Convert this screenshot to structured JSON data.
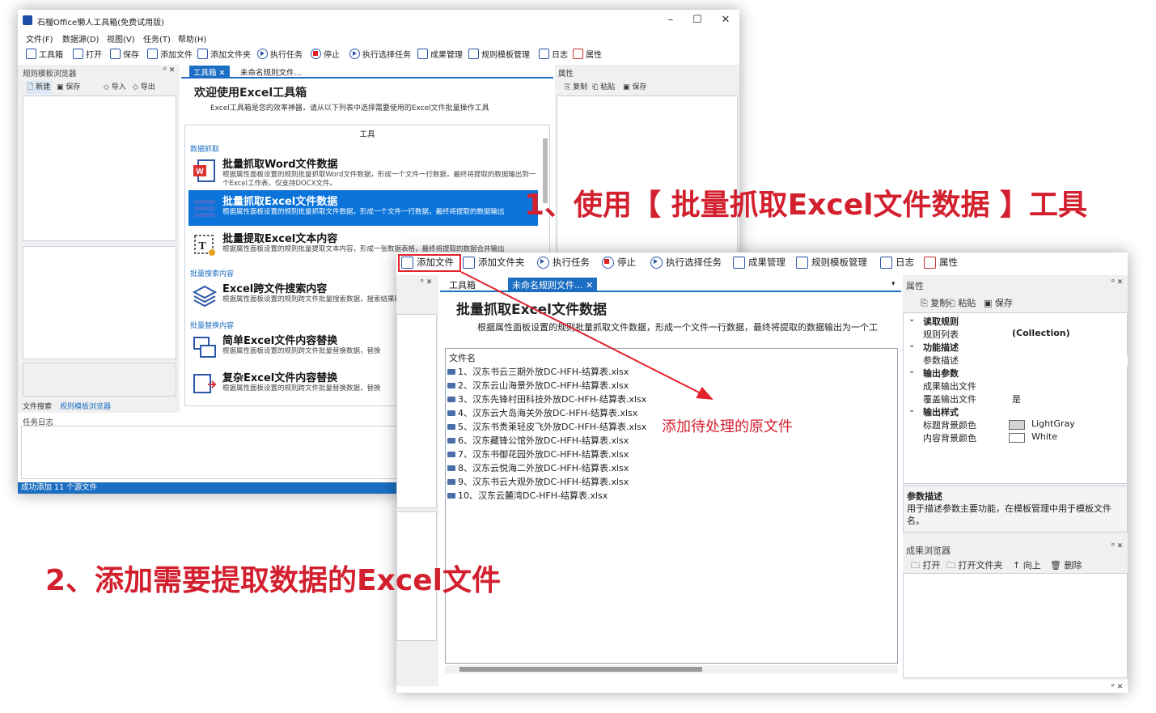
{
  "back_window": {
    "title": "石榴Office懒人工具箱(免费试用版)",
    "menu": [
      "文件(F)",
      "数据源(D)",
      "视图(V)",
      "任务(T)",
      "帮助(H)"
    ],
    "toolbar": [
      "工具箱",
      "打开",
      "保存",
      "添加文件",
      "添加文件夹",
      "执行任务",
      "停止",
      "执行选择任务",
      "成果管理",
      "规则模板管理",
      "日志",
      "属性"
    ],
    "left_panel": {
      "title": "规则模板浏览器",
      "actions": [
        "新建",
        "保存",
        "导入",
        "导出"
      ],
      "bottom_tabs": [
        "文件搜索",
        "规则模板浏览器"
      ]
    },
    "doc_tabs": [
      "工具箱",
      "未命名规则文件..."
    ],
    "welcome_title": "欢迎使用Excel工具箱",
    "welcome_desc": "Excel工具箱是您的效率神器，请从以下列表中选择需要使用的Excel文件批量操作工具",
    "tools_header": "工具",
    "sections": [
      "数据抓取",
      "批量搜索内容",
      "批量替换内容"
    ],
    "tools": [
      {
        "name": "批量抓取Word文件数据",
        "desc": "根据属性面板设置的规则批量抓取Word文件数据，形成一个文件一行数据，最终将提取的数据输出到一个Excel工作表，仅支持DOCX文件。"
      },
      {
        "name": "批量抓取Excel文件数据",
        "desc": "根据属性面板设置的规则批量抓取文件数据，形成一个文件一行数据，最终将提取的数据输出"
      },
      {
        "name": "批量提取Excel文本内容",
        "desc": "根据属性面板设置的规则批量提取文本内容，形成一张数据表格，最终将提取的数据合并输出"
      },
      {
        "name": "Excel跨文件搜索内容",
        "desc": "根据属性面板设置的规则跨文件批量搜索数据，搜索结果输出"
      },
      {
        "name": "简单Excel文件内容替换",
        "desc": "根据属性面板设置的规则跨文件批量替换数据，替换"
      },
      {
        "name": "复杂Excel文件内容替换",
        "desc": "根据属性面板设置的规则跨文件批量替换数据，替换"
      }
    ],
    "right_panel": {
      "title": "属性",
      "actions": [
        "复制",
        "粘贴",
        "保存"
      ]
    },
    "log_title": "任务日志",
    "status": "成功添加 11 个源文件"
  },
  "front_window": {
    "toolbar": [
      "添加文件",
      "添加文件夹",
      "执行任务",
      "停止",
      "执行选择任务",
      "成果管理",
      "规则模板管理",
      "日志",
      "属性"
    ],
    "doc_tabs": [
      "工具箱",
      "未命名规则文件..."
    ],
    "tool_title": "批量抓取Excel文件数据",
    "tool_desc": "根据属性面板设置的规则批量抓取文件数据，形成一个文件一行数据，最终将提取的数据输出为一个工",
    "file_list_header": "文件名",
    "files": [
      "1、汉东书云三期外放DC-HFH-结算表.xlsx",
      "2、汉东云山海景外放DC-HFH-结算表.xlsx",
      "3、汉东先锋村田科技外放DC-HFH-结算表.xlsx",
      "4、汉东云大岛海关外放DC-HFH-结算表.xlsx",
      "5、汉东书贵莱轻皮飞外放DC-HFH-结算表.xlsx",
      "6、汉东藏锋公馆外放DC-HFH-结算表.xlsx",
      "7、汉东书御花园外放DC-HFH-结算表.xlsx",
      "8、汉东云悦海二外放DC-HFH-结算表.xlsx",
      "9、汉东书云大观外放DC-HFH-结算表.xlsx",
      "10、汉东云麓湾DC-HFH-结算表.xlsx"
    ],
    "props": {
      "title": "属性",
      "actions": [
        "复制",
        "粘贴",
        "保存"
      ],
      "rows": [
        {
          "label": "读取规则",
          "value": "",
          "cat": true
        },
        {
          "label": "规则列表",
          "value": "(Collection)",
          "cat": false
        },
        {
          "label": "功能描述",
          "value": "",
          "cat": true
        },
        {
          "label": "参数描述",
          "value": "",
          "cat": false
        },
        {
          "label": "输出参数",
          "value": "",
          "cat": true
        },
        {
          "label": "成果输出文件",
          "value": "",
          "cat": false
        },
        {
          "label": "覆盖输出文件",
          "value": "是",
          "cat": false
        },
        {
          "label": "输出样式",
          "value": "",
          "cat": true
        },
        {
          "label": "标题背景颜色",
          "value": "LightGray",
          "cat": false
        },
        {
          "label": "内容背景颜色",
          "value": "White",
          "cat": false
        }
      ],
      "desc_title": "参数描述",
      "desc_text": "用于描述参数主要功能，在模板管理中用于模板文件名。"
    },
    "results": {
      "title": "成果浏览器",
      "actions": [
        "打开",
        "打开文件夹",
        "向上",
        "删除"
      ]
    }
  },
  "callouts": {
    "step1": "1、使用【 批量抓取Excel文件数据 】工具",
    "step2": "2、添加需要提取数据的Excel文件",
    "note": "添加待处理的原文件"
  },
  "colors": {
    "accent": "#1b6ec2",
    "selection": "#0a74da",
    "callout": "#d3202f"
  }
}
